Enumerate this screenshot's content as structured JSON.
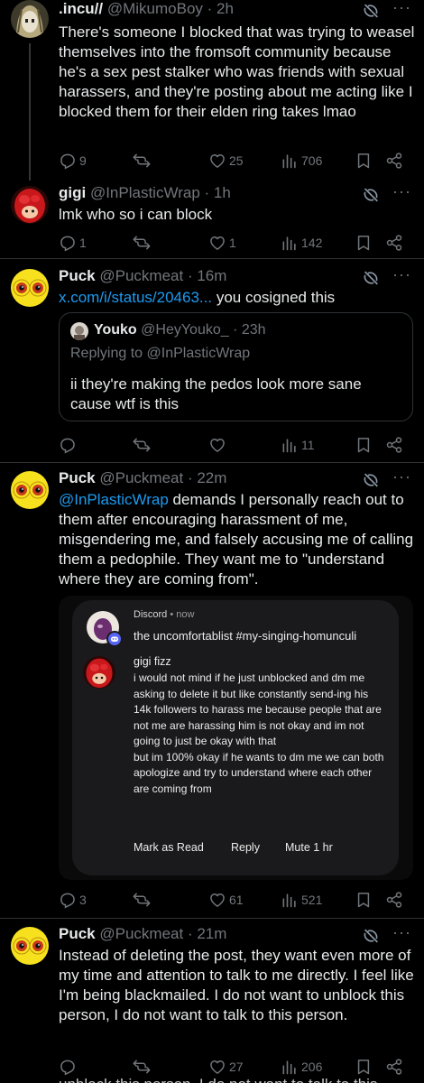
{
  "tweets": [
    {
      "name": ".incu//",
      "handle": "@MikumoBoy",
      "time": "· 2h",
      "text": "There's someone I blocked that was trying to weasel themselves into the fromsoft community because he's a sex pest stalker who was friends with sexual harassers, and they're posting about me acting like I blocked them for their elden ring takes lmao",
      "replies": "9",
      "reposts": "",
      "likes": "25",
      "views": "706"
    },
    {
      "name": "gigi",
      "handle": "@InPlasticWrap",
      "time": "· 1h",
      "text": "lmk who so i can block",
      "replies": "1",
      "reposts": "",
      "likes": "1",
      "views": "142"
    },
    {
      "name": "Puck",
      "handle": "@Puckmeat",
      "time": "· 16m",
      "link": "x.com/i/status/20463...",
      "text_after_link": " you cosigned this",
      "quote": {
        "name": "Youko",
        "handle": "@HeyYouko_",
        "time": "· 23h",
        "replying_prefix": "Replying to ",
        "replying_handle": "@InPlasticWrap",
        "text": "ii they're making the pedos look more sane cause wtf is this"
      },
      "replies": "",
      "reposts": "",
      "likes": "",
      "views": "11"
    },
    {
      "name": "Puck",
      "handle": "@Puckmeat",
      "time": "· 22m",
      "mention": "@InPlasticWrap",
      "text_after_mention": " demands I personally reach out to them after encouraging harassment of me, misgendering me, and falsely accusing me of calling them a pedophile. They want me to \"understand where they are coming from\".",
      "notification": {
        "app": "Discord",
        "time": "• now",
        "channel": "the uncomfortablist #my-singing-homunculi",
        "sender": "gigi fizz",
        "message": "i would not mind if he just unblocked and dm me asking to delete it but like constantly send-ing his 14k followers to harass me because people that are not me are harassing him is not okay and im not going to just be okay with that\nbut im 100% okay if he wants to dm me we can both apologize and try to understand where each other are coming from",
        "actions": [
          "Mark as Read",
          "Reply",
          "Mute 1 hr"
        ]
      },
      "replies": "3",
      "reposts": "",
      "likes": "61",
      "views": "521"
    },
    {
      "name": "Puck",
      "handle": "@Puckmeat",
      "time": "· 21m",
      "text": "Instead of deleting the post, they want even more of my time and attention to talk to me directly. I feel like I'm being blackmailed. I do not want to unblock this person, I do not want to talk to this person.",
      "replies": "",
      "reposts": "",
      "likes": "27",
      "views": "206"
    }
  ],
  "overlay_text": "unblock this person, I do not want to talk to this",
  "colors": {
    "background": "#000000",
    "text": "#e7e9ea",
    "muted": "#71767b",
    "link": "#1d9bf0",
    "divider": "#2f3336"
  },
  "icons": [
    "reply-icon",
    "repost-icon",
    "like-icon",
    "views-icon",
    "bookmark-icon",
    "share-icon",
    "grok-icon",
    "more-icon"
  ]
}
